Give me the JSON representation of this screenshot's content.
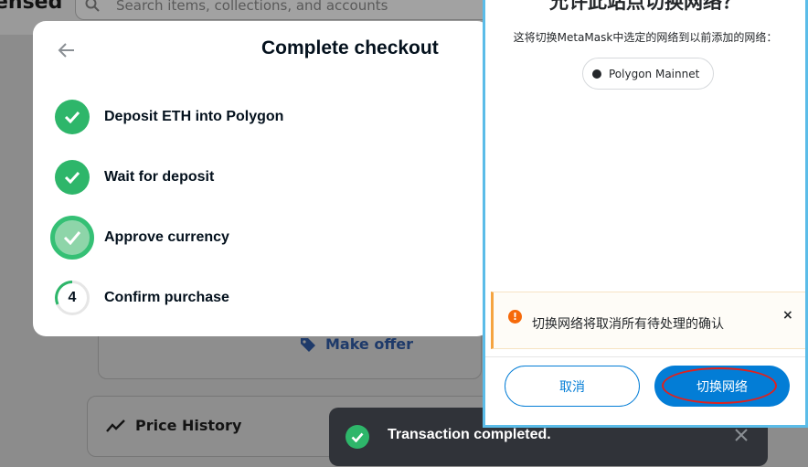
{
  "background": {
    "brand": "ensed",
    "search_placeholder": "Search items, collections, and accounts",
    "make_offer_label": "Make offer",
    "price_history_label": "Price History"
  },
  "checkout": {
    "title": "Complete checkout",
    "steps": [
      {
        "label": "Deposit ETH into Polygon",
        "status": "complete"
      },
      {
        "label": "Wait for deposit",
        "status": "complete"
      },
      {
        "label": "Approve currency",
        "status": "active"
      },
      {
        "label": "Confirm purchase",
        "status": "pending",
        "number": "4"
      }
    ]
  },
  "toast": {
    "message": "Transaction completed."
  },
  "metamask": {
    "heading": "允许此站点切换网络？",
    "description": "这将切换MetaMask中选定的网络到以前添加的网络：",
    "network_name": "Polygon Mainnet",
    "warning_text": "切换网络将取消所有待处理的确认",
    "warning_close": "×",
    "cancel_label": "取消",
    "switch_label": "切换网络"
  },
  "colors": {
    "success_green": "#2eb66a",
    "metamask_blue": "#037dd6",
    "warning_orange": "#f66a0a",
    "highlight_red": "#e0211d"
  }
}
